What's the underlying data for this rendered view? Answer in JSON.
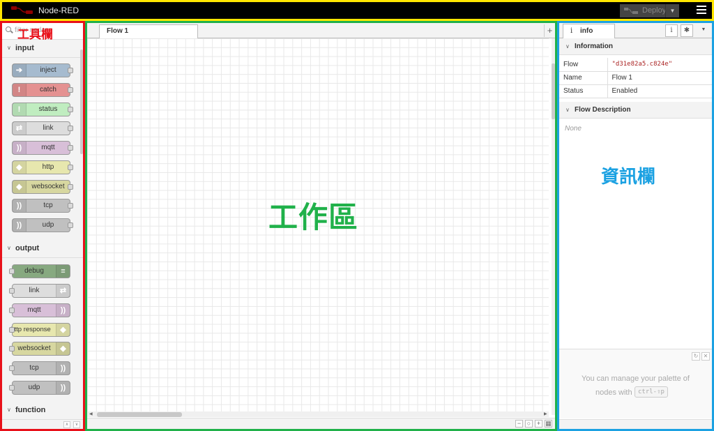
{
  "header": {
    "app_title": "Node-RED",
    "deploy_label": "Deploy",
    "border_color": "#ffe600"
  },
  "palette": {
    "filter_placeholder": "filter nodes",
    "overlay_label": "工具欄",
    "border_color": "#e8111a",
    "categories": [
      {
        "label": "input",
        "nodes": [
          {
            "label": "inject",
            "color": "#a6bbcf",
            "icon": "arrow-icon"
          },
          {
            "label": "catch",
            "color": "#e49191",
            "icon": "exclamation-icon"
          },
          {
            "label": "status",
            "color": "#c0edc0",
            "icon": "exclamation-icon"
          },
          {
            "label": "link",
            "color": "#dddddd",
            "icon": "link-icon"
          },
          {
            "label": "mqtt",
            "color": "#d8bfd8",
            "icon": "bridge-icon"
          },
          {
            "label": "http",
            "color": "#e7e7ae",
            "icon": "globe-icon"
          },
          {
            "label": "websocket",
            "color": "#d7d7a0",
            "icon": "globe-icon"
          },
          {
            "label": "tcp",
            "color": "#c0c0c0",
            "icon": "bridge-icon"
          },
          {
            "label": "udp",
            "color": "#c0c0c0",
            "icon": "bridge-icon"
          }
        ]
      },
      {
        "label": "output",
        "nodes": [
          {
            "label": "debug",
            "color": "#87a980",
            "icon": "debug-icon"
          },
          {
            "label": "link",
            "color": "#dddddd",
            "icon": "link-icon"
          },
          {
            "label": "mqtt",
            "color": "#d8bfd8",
            "icon": "bridge-icon"
          },
          {
            "label": "http response",
            "color": "#e7e7ae",
            "icon": "globe-icon"
          },
          {
            "label": "websocket",
            "color": "#d7d7a0",
            "icon": "globe-icon"
          },
          {
            "label": "tcp",
            "color": "#c0c0c0",
            "icon": "bridge-icon"
          },
          {
            "label": "udp",
            "color": "#c0c0c0",
            "icon": "bridge-icon"
          }
        ]
      },
      {
        "label": "function",
        "nodes": []
      }
    ]
  },
  "workspace": {
    "tab_label": "Flow 1",
    "add_tab": "+",
    "overlay_label": "工作區",
    "border_color": "#20b14a",
    "zoom_out": "−",
    "zoom_reset": "○",
    "zoom_in": "+"
  },
  "sidebar": {
    "tab_label": "info",
    "overlay_label": "資訊欄",
    "border_color": "#1ba1e2",
    "info_section": "Information",
    "rows": [
      {
        "key": "Flow",
        "value": "\"d31e82a5.c824e\""
      },
      {
        "key": "Name",
        "value": "Flow 1"
      },
      {
        "key": "Status",
        "value": "Enabled"
      }
    ],
    "desc_section": "Flow Description",
    "desc_value": "None",
    "tip_line1": "You can manage your palette of",
    "tip_line2": "nodes with",
    "tip_kbd": "ctrl-⇧p"
  }
}
